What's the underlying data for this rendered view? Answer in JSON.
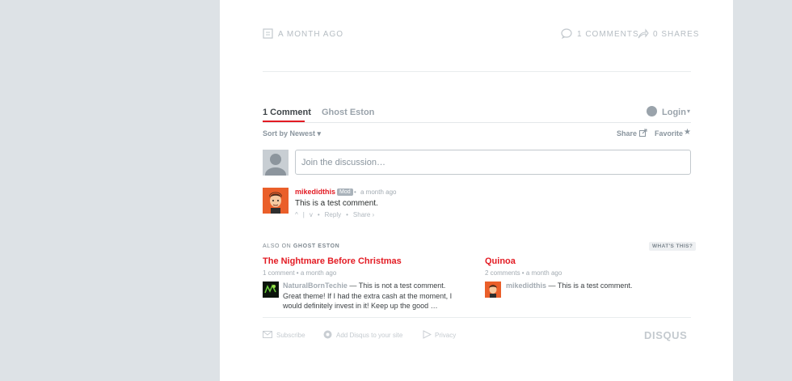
{
  "post_meta": {
    "date": "A MONTH AGO",
    "comments": "1 COMMENTS",
    "shares": "0 SHARES"
  },
  "disqus": {
    "tabs": [
      "1 Comment",
      "Ghost Eston"
    ],
    "login": "Login",
    "sort": "Sort by Newest",
    "share": "Share",
    "favorite": "Favorite",
    "input_placeholder": "Join the discussion…",
    "comment": {
      "author": "mikedidthis",
      "badge": "Mod",
      "time": "a month ago",
      "text": "This is a test comment.",
      "reply": "Reply",
      "share": "Share ›",
      "up": "^",
      "down": "v"
    },
    "also_on": {
      "prefix": "ALSO ON",
      "site": "GHOST ESTON",
      "whats_this": "WHAT'S THIS?"
    },
    "posts": [
      {
        "title": "The Nightmare Before Christmas",
        "meta": "1 comment • a month ago",
        "author": "NaturalBornTechie",
        "text": "— This is not a test comment.",
        "text2": "Great theme! If I had the extra cash at the moment, I",
        "text3": "would definitely invest in it! Keep up the good …"
      },
      {
        "title": "Quinoa",
        "meta": "2 comments • a month ago",
        "author": "mikedidthis",
        "text": "— This is a test comment."
      }
    ],
    "footer": {
      "subscribe": "Subscribe",
      "add_disqus": "Add Disqus to your site",
      "privacy": "Privacy",
      "brand": "DISQUS"
    }
  },
  "colors": {
    "accent_red": "#e31b23",
    "muted": "#b6bdc3",
    "background": "#dde2e6"
  }
}
